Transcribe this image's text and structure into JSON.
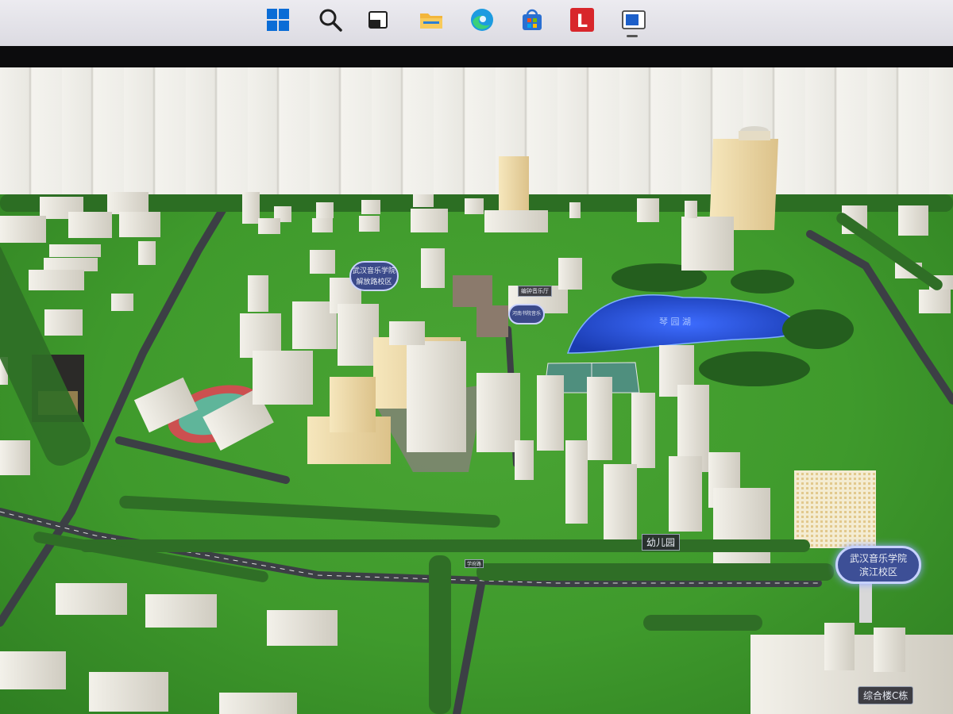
{
  "taskbar": {
    "icons": [
      {
        "name": "windows-start-icon",
        "color": "#0a6cd6"
      },
      {
        "name": "search-icon",
        "color": "#1f1f1f"
      },
      {
        "name": "task-view-icon",
        "color": "#1f1f1f"
      },
      {
        "name": "file-explorer-icon",
        "color": "#f3b63b"
      },
      {
        "name": "edge-browser-icon",
        "color": "#1d9be0"
      },
      {
        "name": "microsoft-store-icon",
        "color": "#2a6fd1"
      },
      {
        "name": "red-l-app-icon",
        "color": "#d8262b",
        "glyph": "L"
      },
      {
        "name": "active-window-icon",
        "color": "#1c5fc9"
      }
    ]
  },
  "model_labels": {
    "campus_liberation_line1": "武汉音乐学院",
    "campus_liberation_line2": "解放路校区",
    "concert_hall": "编钟音乐厅",
    "music_hall": "河南书院音乐",
    "lake": "琴 园 湖",
    "kindergarten": "幼儿园",
    "campus_binjiang_line1": "武汉音乐学院",
    "campus_binjiang_line2": "滨江校区",
    "complex_building": "综合楼C栋",
    "road_small": "学府路"
  },
  "colors": {
    "grass": "#3f9a2c",
    "road": "#3c3f45",
    "lake": "#2d57d6",
    "track": "#cc5050",
    "field": "#5fb59a",
    "wall": "#efeee8"
  }
}
